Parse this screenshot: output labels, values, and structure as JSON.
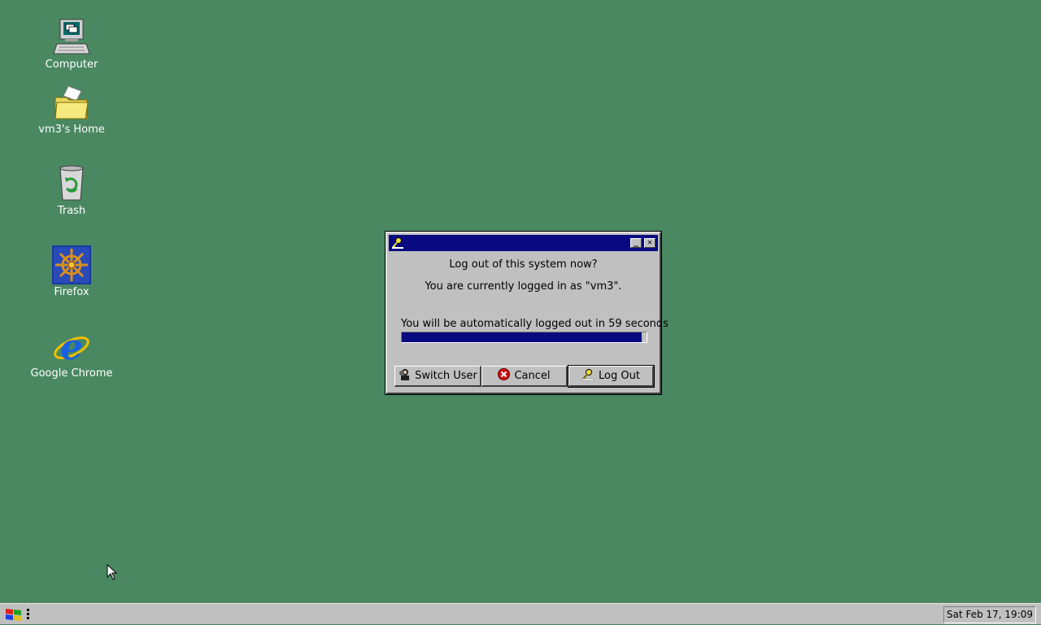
{
  "desktop": {
    "icons": [
      {
        "label": "Computer",
        "icon": "computer-icon"
      },
      {
        "label": "vm3's Home",
        "icon": "home-folder-icon"
      },
      {
        "label": "Trash",
        "icon": "trash-icon"
      },
      {
        "label": "Firefox",
        "icon": "firefox-icon"
      },
      {
        "label": "Google Chrome",
        "icon": "chrome-icon"
      }
    ],
    "background_color": "#4a8862"
  },
  "dialog": {
    "question": "Log out of this system now?",
    "logged_in_text": "You are currently logged in as \"vm3\".",
    "countdown_text": "You will be automatically logged out in 59 seconds",
    "progress_fraction": 0.98,
    "buttons": {
      "switch_user": "Switch User",
      "cancel": "Cancel",
      "log_out": "Log Out"
    },
    "title_color": "#0a0a80"
  },
  "taskbar": {
    "clock": "Sat Feb 17, 19:09"
  }
}
